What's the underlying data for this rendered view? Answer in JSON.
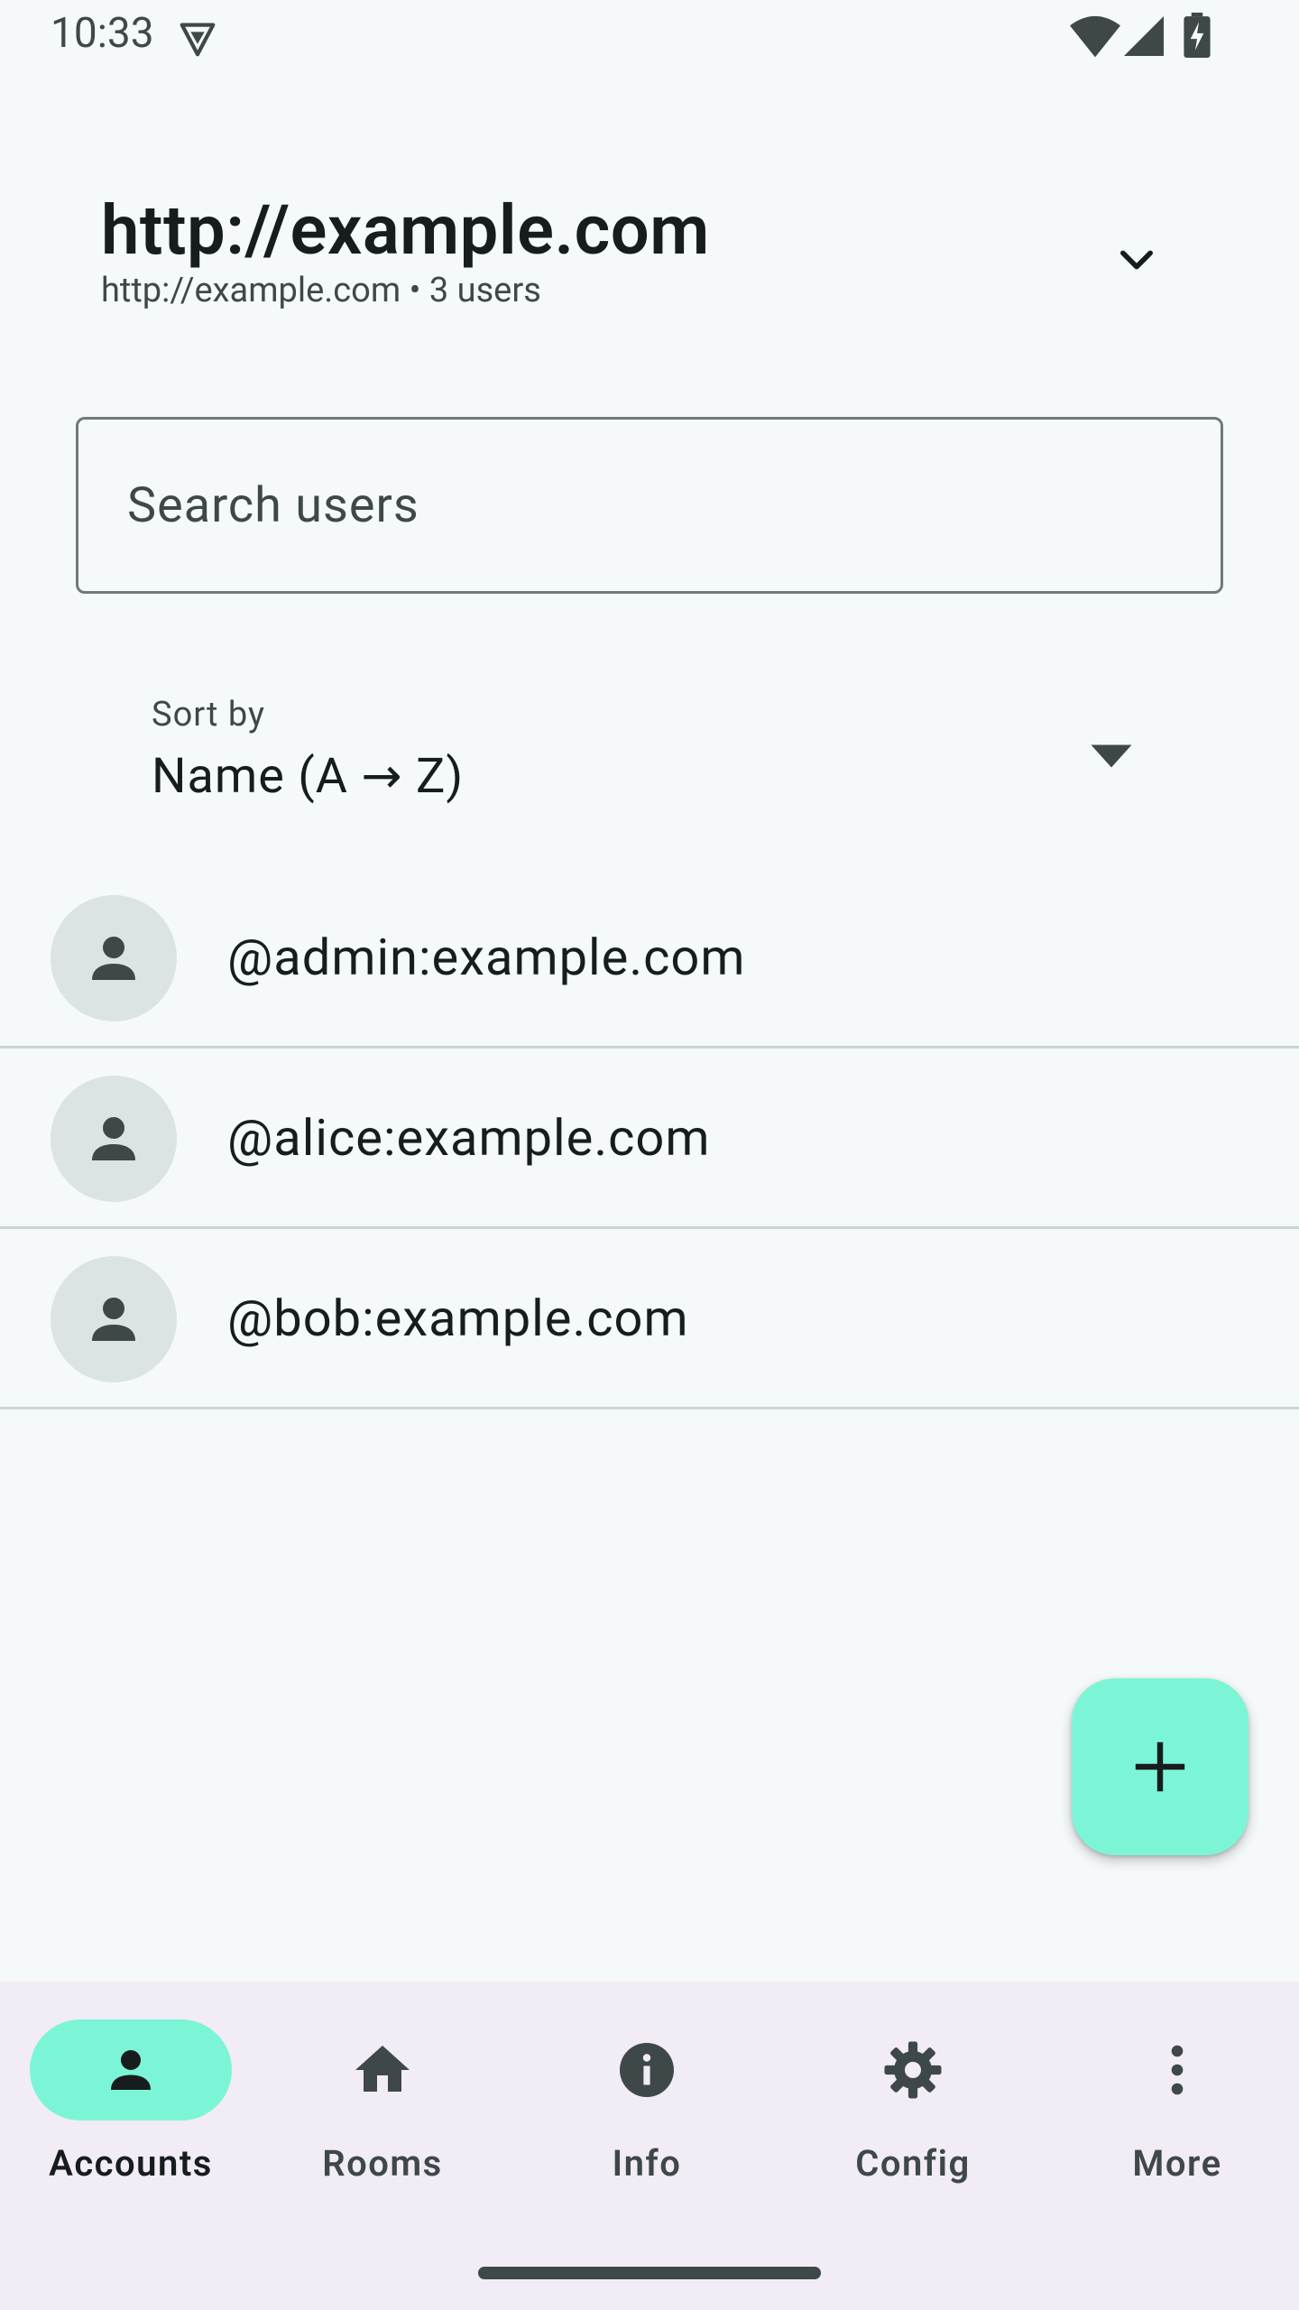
{
  "status_bar": {
    "time": "10:33",
    "icons": [
      "vpn-shield-icon",
      "wifi-icon",
      "signal-icon",
      "battery-charging-icon"
    ]
  },
  "header": {
    "title": "http://example.com",
    "subtitle": "http://example.com • 3 users",
    "switch_icon": "chevron-down-icon"
  },
  "search": {
    "placeholder": "Search users",
    "value": ""
  },
  "sort": {
    "label": "Sort by",
    "value": "Name (A → Z)",
    "arrow_icon": "dropdown-arrow-icon"
  },
  "users": [
    {
      "name": "@admin:example.com",
      "icon": "person-icon"
    },
    {
      "name": "@alice:example.com",
      "icon": "person-icon"
    },
    {
      "name": "@bob:example.com",
      "icon": "person-icon"
    }
  ],
  "fab": {
    "icon": "plus-icon"
  },
  "bottom_nav": {
    "items": [
      {
        "label": "Accounts",
        "icon": "person-icon",
        "active": true
      },
      {
        "label": "Rooms",
        "icon": "home-icon",
        "active": false
      },
      {
        "label": "Info",
        "icon": "info-icon",
        "active": false
      },
      {
        "label": "Config",
        "icon": "gear-icon",
        "active": false
      },
      {
        "label": "More",
        "icon": "more-vertical-icon",
        "active": false
      }
    ]
  },
  "colors": {
    "background": "#f5f9f9",
    "accent": "#7cf5d6",
    "nav_background": "#f1ecf6",
    "avatar_background": "#dbe4e3",
    "icon_dark": "#3f4848"
  }
}
